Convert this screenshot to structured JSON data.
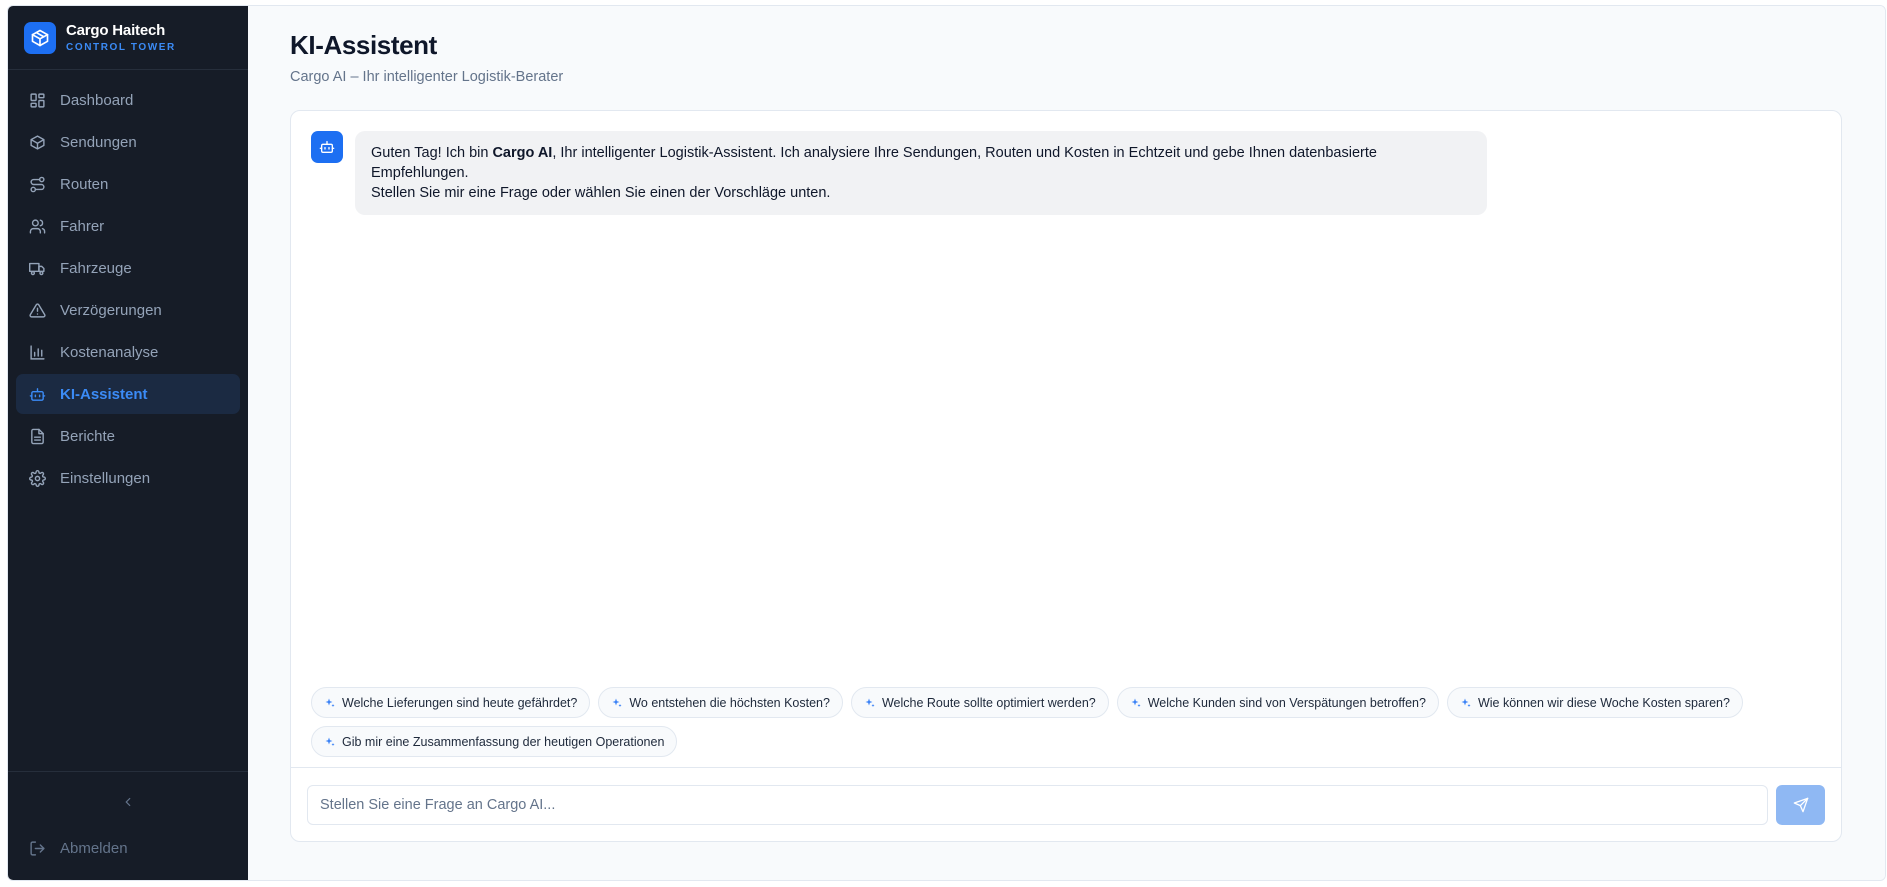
{
  "brand": {
    "name": "Cargo Haitech",
    "subtitle": "CONTROL TOWER"
  },
  "sidebar": {
    "items": [
      {
        "label": "Dashboard",
        "icon": "dashboard-icon"
      },
      {
        "label": "Sendungen",
        "icon": "package-icon"
      },
      {
        "label": "Routen",
        "icon": "route-icon"
      },
      {
        "label": "Fahrer",
        "icon": "users-icon"
      },
      {
        "label": "Fahrzeuge",
        "icon": "truck-icon"
      },
      {
        "label": "Verzögerungen",
        "icon": "warning-icon"
      },
      {
        "label": "Kostenanalyse",
        "icon": "bar-chart-icon"
      },
      {
        "label": "KI-Assistent",
        "icon": "bot-icon",
        "active": true
      },
      {
        "label": "Berichte",
        "icon": "file-text-icon"
      },
      {
        "label": "Einstellungen",
        "icon": "gear-icon"
      }
    ],
    "logout_label": "Abmelden"
  },
  "header": {
    "title": "KI-Assistent",
    "subtitle": "Cargo AI – Ihr intelligenter Logistik-Berater"
  },
  "chat": {
    "message": {
      "prefix": "Guten Tag! Ich bin ",
      "bold": "Cargo AI",
      "rest": ", Ihr intelligenter Logistik-Assistent. Ich analysiere Ihre Sendungen, Routen und Kosten in Echtzeit und gebe Ihnen datenbasierte Empfehlungen.",
      "line2": "Stellen Sie mir eine Frage oder wählen Sie einen der Vorschläge unten."
    },
    "suggestions": [
      "Welche Lieferungen sind heute gefährdet?",
      "Wo entstehen die höchsten Kosten?",
      "Welche Route sollte optimiert werden?",
      "Welche Kunden sind von Verspätungen betroffen?",
      "Wie können wir diese Woche Kosten sparen?",
      "Gib mir eine Zusammenfassung der heutigen Operationen"
    ],
    "input_placeholder": "Stellen Sie eine Frage an Cargo AI...",
    "input_value": ""
  },
  "colors": {
    "accent": "#1d6ff2",
    "sidebar_bg": "#161c27",
    "active_bg": "#1b2a42",
    "send_disabled": "#8fb8f3"
  }
}
